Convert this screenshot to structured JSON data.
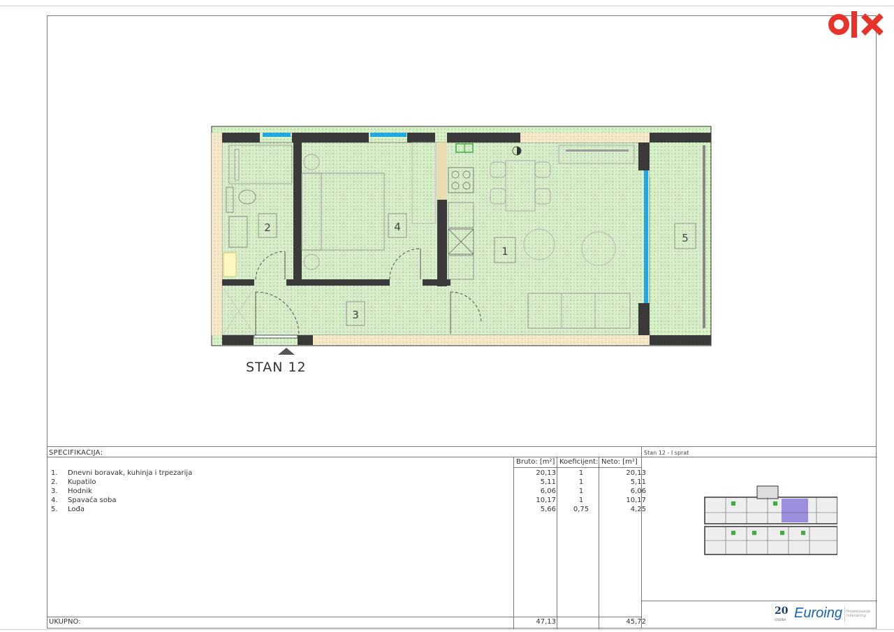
{
  "logo": {
    "text": "olx",
    "color": "#e8332a"
  },
  "apartment_label": "STAN 12",
  "rooms": [
    "1",
    "2",
    "3",
    "4",
    "5"
  ],
  "spec": {
    "title": "SPECIFIKACIJA:",
    "columns": {
      "bruto": "Bruto: [m²]",
      "koef": "Koeficijent:",
      "neto": "Neto: [m²]"
    },
    "rows": [
      {
        "num": "1.",
        "name": "Dnevni boravak, kuhinja i trpezarija",
        "bruto": "20,13",
        "koef": "1",
        "neto": "20,13"
      },
      {
        "num": "2.",
        "name": "Kupatilo",
        "bruto": "5,11",
        "koef": "1",
        "neto": "5,11"
      },
      {
        "num": "3.",
        "name": "Hodnik",
        "bruto": "6,06",
        "koef": "1",
        "neto": "6,06"
      },
      {
        "num": "4.",
        "name": "Spavaća soba",
        "bruto": "10,17",
        "koef": "1",
        "neto": "10,17"
      },
      {
        "num": "5.",
        "name": "Lođa",
        "bruto": "5,66",
        "koef": "0,75",
        "neto": "4,25"
      }
    ],
    "total": {
      "label": "UKUPNO:",
      "bruto": "47,13",
      "neto": "45,72"
    }
  },
  "side": {
    "title": "Stan 12 - I sprat"
  },
  "brand": {
    "anniv": "20",
    "anniv_sub": "GODINA",
    "name": "Euroing",
    "sub": "Projektovanje Inženjering"
  },
  "colors": {
    "wall": "#3a3a3a",
    "insulation": "#f2e6c0",
    "green": "#4caf50",
    "window": "#22a8e0",
    "highlight": "#8e7bdc"
  }
}
